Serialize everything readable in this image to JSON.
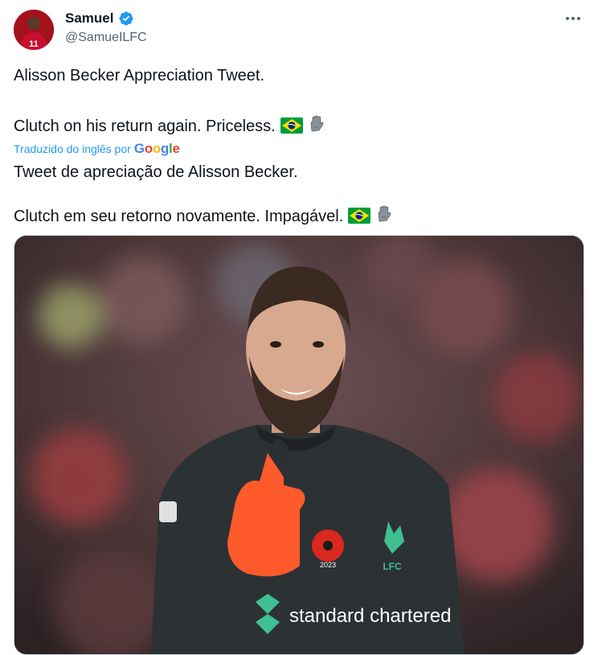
{
  "tweet": {
    "author": {
      "display_name": "Samuel",
      "handle": "@SamueILFC",
      "verified": true,
      "avatar_jersey_number": "11"
    },
    "original_lines": [
      "Alisson Becker Appreciation Tweet.",
      "Clutch on his return again. Priceless."
    ],
    "translation_label": "Traduzido do inglês por",
    "translation_provider": "Google",
    "translated_lines": [
      "Tweet de apreciação de Alisson Becker.",
      "Clutch em seu retorno novamente. Impagável."
    ],
    "emojis": [
      "brazil-flag",
      "gloves"
    ],
    "media": {
      "shirt_sponsor": "standard chartered",
      "badge_text": "LFC",
      "poppy_year": "2023"
    }
  },
  "colors": {
    "link_blue": "#1d9bf0",
    "secondary_text": "#536471",
    "verified_blue": "#1d9bf0"
  }
}
